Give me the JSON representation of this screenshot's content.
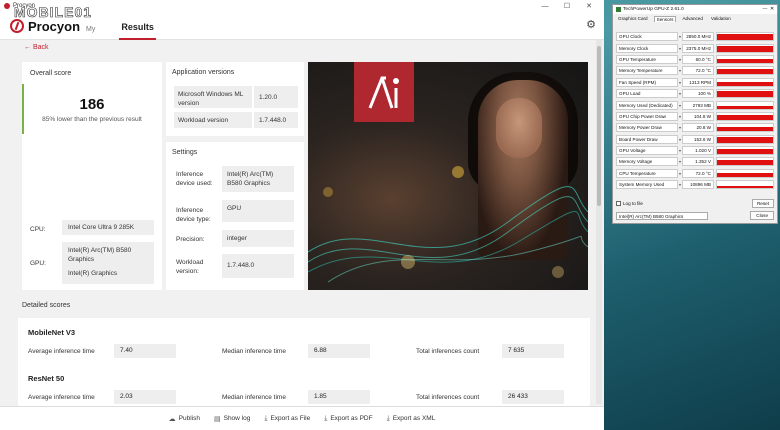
{
  "window": {
    "title": "Procyon",
    "minimize": "—",
    "maximize": "☐",
    "close": "✕"
  },
  "header": {
    "brand": "Procyon",
    "brand_sub": "My",
    "tab_results": "Results",
    "back_label": "Back"
  },
  "overall": {
    "label": "Overall score",
    "score": "186",
    "comparison": "85% lower than the previous result",
    "cpu_label": "CPU:",
    "cpu_value": "Intel Core Ultra 9 285K",
    "gpu_label": "GPU:",
    "gpu_value_1": "Intel(R) Arc(TM) B580 Graphics",
    "gpu_value_2": "Intel(R) Graphics"
  },
  "app_versions": {
    "title": "Application versions",
    "rows": [
      {
        "key": "Microsoft Windows ML version",
        "value": "1.20.0"
      },
      {
        "key": "Workload version",
        "value": "1.7.448.0"
      }
    ]
  },
  "settings": {
    "title": "Settings",
    "rows": [
      {
        "key": "Inference device used:",
        "value": "Intel(R) Arc(TM) B580 Graphics"
      },
      {
        "key": "Inference device type:",
        "value": "GPU"
      },
      {
        "key": "Precision:",
        "value": "integer"
      },
      {
        "key": "Workload version:",
        "value": "1.7.448.0"
      }
    ]
  },
  "detailed": {
    "title": "Detailed scores",
    "tests": [
      {
        "name": "MobileNet V3",
        "avg_label": "Average inference time",
        "avg": "7.40",
        "median_label": "Median inference time",
        "median": "6.88",
        "total_label": "Total inferences count",
        "total": "7 635"
      },
      {
        "name": "ResNet 50",
        "avg_label": "Average inference time",
        "avg": "2.03",
        "median_label": "Median inference time",
        "median": "1.85",
        "total_label": "Total inferences count",
        "total": "26 433"
      }
    ]
  },
  "footer": {
    "publish": "Publish",
    "show_log": "Show log",
    "export_file": "Export as File",
    "export_pdf": "Export as PDF",
    "export_xml": "Export as XML"
  },
  "watermark": "MOBILE01",
  "gpuz": {
    "title": "TechPowerUp GPU-Z 2.61.0",
    "tabs": [
      "Graphics Card",
      "Sensors",
      "Advanced",
      "Validation"
    ],
    "sensors": [
      {
        "label": "GPU Clock",
        "value": "2850.0 MHz",
        "level": 0.85
      },
      {
        "label": "Memory Clock",
        "value": "2375.0 MHz",
        "level": 0.85
      },
      {
        "label": "GPU Temperature",
        "value": "60.0 °C",
        "level": 0.6
      },
      {
        "label": "Memory Temperature",
        "value": "72.0 °C",
        "level": 0.7
      },
      {
        "label": "Fan Speed (RPM)",
        "value": "1313 RPM",
        "level": 0.5
      },
      {
        "label": "GPU Load",
        "value": "100 %",
        "level": 0.9
      },
      {
        "label": "Memory Used (Dedicated)",
        "value": "2793 MB",
        "level": 0.4
      },
      {
        "label": "GPU Chip Power Draw",
        "value": "104.8 W",
        "level": 0.7
      },
      {
        "label": "Memory Power Draw",
        "value": "20.8 W",
        "level": 0.6
      },
      {
        "label": "Board Power Draw",
        "value": "153.6 W",
        "level": 0.75
      },
      {
        "label": "GPU Voltage",
        "value": "1.020 V",
        "level": 0.7
      },
      {
        "label": "Memory Voltage",
        "value": "1.352 V",
        "level": 0.75
      },
      {
        "label": "CPU Temperature",
        "value": "72.0 °C",
        "level": 0.5
      },
      {
        "label": "System Memory Used",
        "value": "10896 MB",
        "level": 0.3
      }
    ],
    "log_to_file": "Log to file",
    "reset": "Reset",
    "device": "Intel(R) Arc(TM) B580 Graphics",
    "close": "Close"
  }
}
